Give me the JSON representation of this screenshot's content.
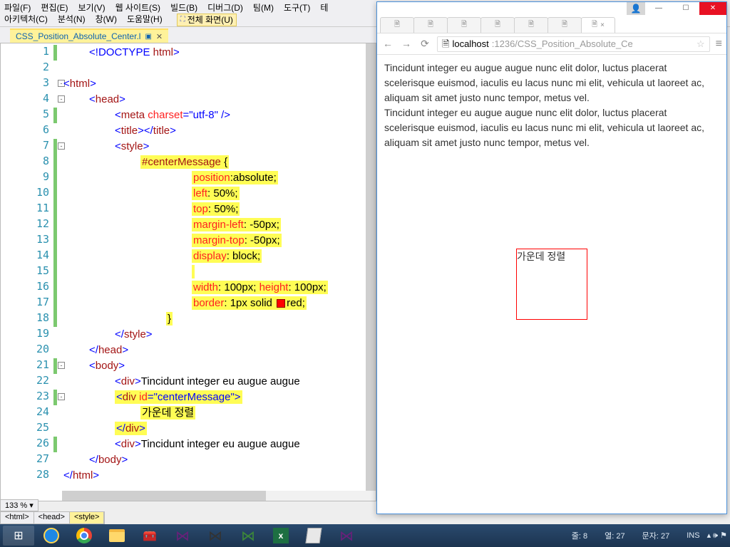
{
  "menubar": {
    "row1": [
      "파일(F)",
      "편집(E)",
      "보기(V)",
      "웹 사이트(S)",
      "빌드(B)",
      "디버그(D)",
      "팀(M)",
      "도구(T)",
      "테"
    ],
    "row2": [
      "아키텍처(C)",
      "분석(N)",
      "창(W)",
      "도움말(H)"
    ],
    "fullscreen": "전체 화면(U)"
  },
  "doctab": {
    "title": "CSS_Position_Absolute_Center.l",
    "close": "✕"
  },
  "code": {
    "lines": [
      {
        "n": "1",
        "ind": 1,
        "frag": [
          [
            "pun",
            "<!"
          ],
          [
            "doct",
            "DOCTYPE"
          ],
          [
            "txt",
            " "
          ],
          [
            "tag",
            "html"
          ],
          [
            "pun",
            ">"
          ]
        ]
      },
      {
        "n": "2",
        "ind": 1,
        "frag": []
      },
      {
        "n": "3",
        "ind": 0,
        "fold": "-",
        "frag": [
          [
            "pun",
            "<"
          ],
          [
            "tag",
            "html"
          ],
          [
            "pun",
            ">"
          ]
        ]
      },
      {
        "n": "4",
        "ind": 1,
        "fold": "-",
        "frag": [
          [
            "pun",
            "<"
          ],
          [
            "tag",
            "head"
          ],
          [
            "pun",
            ">"
          ]
        ]
      },
      {
        "n": "5",
        "ind": 2,
        "frag": [
          [
            "pun",
            "<"
          ],
          [
            "tag",
            "meta"
          ],
          [
            "txt",
            " "
          ],
          [
            "attr",
            "charset"
          ],
          [
            "pun",
            "="
          ],
          [
            "str",
            "\"utf-8\""
          ],
          [
            "txt",
            " "
          ],
          [
            "pun",
            "/>"
          ]
        ]
      },
      {
        "n": "6",
        "ind": 2,
        "frag": [
          [
            "pun",
            "<"
          ],
          [
            "tag",
            "title"
          ],
          [
            "pun",
            "></"
          ],
          [
            "tag",
            "title"
          ],
          [
            "pun",
            ">"
          ]
        ]
      },
      {
        "n": "7",
        "ind": 2,
        "fold": "-",
        "frag": [
          [
            "pun",
            "<"
          ],
          [
            "tag",
            "style"
          ],
          [
            "pun",
            ">"
          ]
        ]
      },
      {
        "n": "8",
        "ind": 3,
        "hl": true,
        "frag": [
          [
            "tag",
            "#centerMessage"
          ],
          [
            "txt",
            " {"
          ]
        ]
      },
      {
        "n": "9",
        "ind": 5,
        "hl": true,
        "frag": [
          [
            "attr",
            "position"
          ],
          [
            "txt",
            ":absolute;"
          ]
        ]
      },
      {
        "n": "10",
        "ind": 5,
        "hl": true,
        "frag": [
          [
            "attr",
            "left"
          ],
          [
            "txt",
            ": 50%;"
          ]
        ]
      },
      {
        "n": "11",
        "ind": 5,
        "hl": true,
        "frag": [
          [
            "attr",
            "top"
          ],
          [
            "txt",
            ": 50%;"
          ]
        ]
      },
      {
        "n": "12",
        "ind": 5,
        "hl": true,
        "frag": [
          [
            "attr",
            "margin-left"
          ],
          [
            "txt",
            ": -50px;"
          ]
        ]
      },
      {
        "n": "13",
        "ind": 5,
        "hl": true,
        "frag": [
          [
            "attr",
            "margin-top"
          ],
          [
            "txt",
            ": -50px;"
          ]
        ]
      },
      {
        "n": "14",
        "ind": 5,
        "hl": true,
        "frag": [
          [
            "attr",
            "display"
          ],
          [
            "txt",
            ": block;"
          ]
        ]
      },
      {
        "n": "15",
        "ind": 5,
        "hl": true,
        "frag": []
      },
      {
        "n": "16",
        "ind": 5,
        "hl": true,
        "frag": [
          [
            "attr",
            "width"
          ],
          [
            "txt",
            ": 100px; "
          ],
          [
            "attr",
            "height"
          ],
          [
            "txt",
            ": 100px;"
          ]
        ]
      },
      {
        "n": "17",
        "ind": 5,
        "hl": true,
        "frag": [
          [
            "attr",
            "border"
          ],
          [
            "txt",
            ": 1px solid "
          ],
          [
            "colorbox",
            ""
          ],
          [
            "txt",
            "red;"
          ]
        ]
      },
      {
        "n": "18",
        "ind": 4,
        "hl": true,
        "frag": [
          [
            "txt",
            "}"
          ]
        ]
      },
      {
        "n": "19",
        "ind": 2,
        "frag": [
          [
            "pun",
            "</"
          ],
          [
            "tag",
            "style"
          ],
          [
            "pun",
            ">"
          ]
        ]
      },
      {
        "n": "20",
        "ind": 1,
        "frag": [
          [
            "pun",
            "</"
          ],
          [
            "tag",
            "head"
          ],
          [
            "pun",
            ">"
          ]
        ]
      },
      {
        "n": "21",
        "ind": 1,
        "fold": "-",
        "frag": [
          [
            "pun",
            "<"
          ],
          [
            "tag",
            "body"
          ],
          [
            "pun",
            ">"
          ]
        ]
      },
      {
        "n": "22",
        "ind": 2,
        "frag": [
          [
            "pun",
            "<"
          ],
          [
            "tag",
            "div"
          ],
          [
            "pun",
            ">"
          ],
          [
            "txt",
            "Tincidunt integer eu augue augue"
          ]
        ]
      },
      {
        "n": "23",
        "ind": 2,
        "fold": "-",
        "hl": true,
        "frag": [
          [
            "pun",
            "<"
          ],
          [
            "tag",
            "div"
          ],
          [
            "txt",
            " "
          ],
          [
            "attr",
            "id"
          ],
          [
            "pun",
            "="
          ],
          [
            "str",
            "\"centerMessage\""
          ],
          [
            "pun",
            ">"
          ]
        ]
      },
      {
        "n": "24",
        "ind": 3,
        "hl": true,
        "frag": [
          [
            "txt",
            "가운데 정렬"
          ]
        ]
      },
      {
        "n": "25",
        "ind": 2,
        "hl": true,
        "frag": [
          [
            "pun",
            "</"
          ],
          [
            "tag",
            "div"
          ],
          [
            "pun",
            ">"
          ]
        ]
      },
      {
        "n": "26",
        "ind": 2,
        "frag": [
          [
            "pun",
            "<"
          ],
          [
            "tag",
            "div"
          ],
          [
            "pun",
            ">"
          ],
          [
            "txt",
            "Tincidunt integer eu augue augue"
          ]
        ]
      },
      {
        "n": "27",
        "ind": 1,
        "frag": [
          [
            "pun",
            "</"
          ],
          [
            "tag",
            "body"
          ],
          [
            "pun",
            ">"
          ]
        ]
      },
      {
        "n": "28",
        "ind": 0,
        "frag": [
          [
            "pun",
            "</"
          ],
          [
            "tag",
            "html"
          ],
          [
            "pun",
            ">"
          ]
        ]
      }
    ],
    "modbars": [
      {
        "from": 1,
        "to": 1
      },
      {
        "from": 5,
        "to": 5
      },
      {
        "from": 7,
        "to": 18
      },
      {
        "from": 21,
        "to": 21
      },
      {
        "from": 23,
        "to": 23
      },
      {
        "from": 26,
        "to": 26
      }
    ]
  },
  "zoom": "133 %",
  "breadcrumb": [
    "<html>",
    "<head>",
    "<style>"
  ],
  "browser": {
    "url_doc_icon": "🗎",
    "url_host": "localhost",
    "url_path": ":1236/CSS_Position_Absolute_Ce",
    "para": "Tincidunt integer eu augue augue nunc elit dolor, luctus placerat scelerisque euismod, iaculis eu lacus nunc mi elit, vehicula ut laoreet ac, aliquam sit amet justo nunc tempor, metus vel.",
    "center": "가운데 정렬"
  },
  "statusbar": {
    "line": "줄: 8",
    "col": "열: 27",
    "char": "문자: 27",
    "ins": "INS"
  },
  "taskbar": {
    "start": "⊞"
  }
}
